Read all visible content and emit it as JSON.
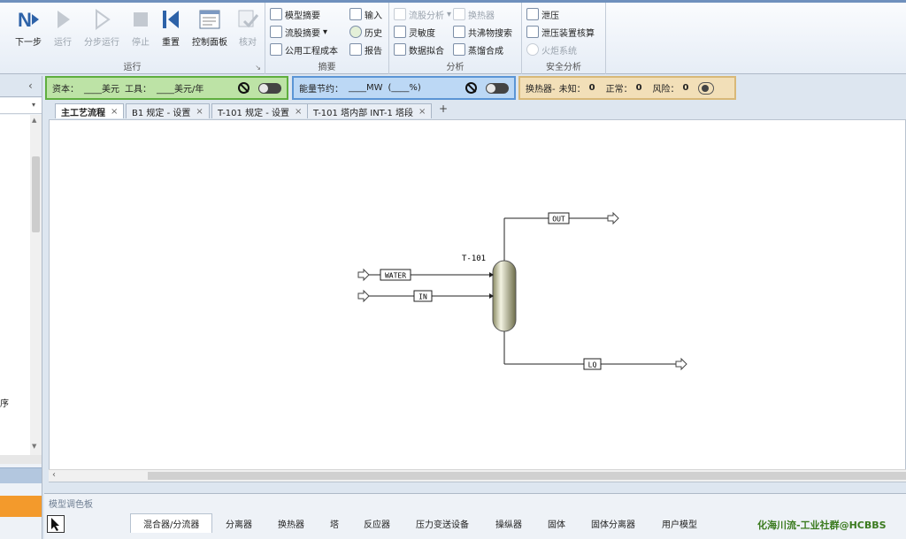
{
  "ribbon": {
    "run_group": {
      "label": "运行",
      "buttons": [
        {
          "label": "下一步",
          "icon": "next-icon"
        },
        {
          "label": "运行",
          "icon": "run-icon"
        },
        {
          "label": "分步运行",
          "icon": "step-run-icon"
        },
        {
          "label": "停止",
          "icon": "stop-icon"
        },
        {
          "label": "重置",
          "icon": "reset-icon"
        },
        {
          "label": "控制面板",
          "icon": "control-panel-icon"
        },
        {
          "label": "核对",
          "icon": "check-icon"
        }
      ]
    },
    "summary_group": {
      "label": "摘要",
      "items": [
        "模型摘要",
        "流股摘要",
        "公用工程成本",
        "输入",
        "历史",
        "报告"
      ]
    },
    "analysis_group": {
      "label": "分析",
      "items": [
        "流股分析",
        "换热器",
        "灵敏度",
        "共沸物搜索",
        "数据拟合",
        "蒸馏合成"
      ]
    },
    "safety_group": {
      "label": "安全分析",
      "items": [
        "泄压",
        "泄压装置核算",
        "火炬系统"
      ]
    }
  },
  "status_bar": {
    "capital_label": "资本：",
    "capital_value": "____美元",
    "utility_label": "工具：",
    "utility_value": "____美元/年",
    "energy_label": "能量节约：",
    "energy_value": "____MW",
    "energy_percent": "(____%)",
    "hx_label": "换热器-",
    "hx_unknown_label": "未知：",
    "hx_unknown": "0",
    "hx_normal_label": "正常：",
    "hx_normal": "0",
    "hx_risk_label": "风险：",
    "hx_risk": "0"
  },
  "tabs": [
    "主工艺流程",
    "B1 规定 - 设置",
    "T-101 规定 - 设置",
    "T-101 塔内部 INT-1 塔段"
  ],
  "tab_close": "×",
  "tab_add": "+",
  "flowsheet": {
    "block_name": "T-101",
    "streams": [
      "WATER",
      "IN",
      "OUT",
      "LQ"
    ]
  },
  "palette": {
    "title": "模型调色板",
    "tabs": [
      "混合器/分流器",
      "分离器",
      "换热器",
      "塔",
      "反应器",
      "压力变送设备",
      "操纵器",
      "固体",
      "固体分离器",
      "用户模型"
    ]
  },
  "left_panel": {
    "partial_char": "序"
  },
  "watermark": "化海川流-工业社群@HCBBS",
  "colors": {
    "capital_bg": "#bde3a6",
    "energy_bg": "#bcd8f5",
    "hx_bg": "#f2dfb8",
    "accent": "#2d62a8",
    "palette_highlight": "#f39a2c"
  }
}
